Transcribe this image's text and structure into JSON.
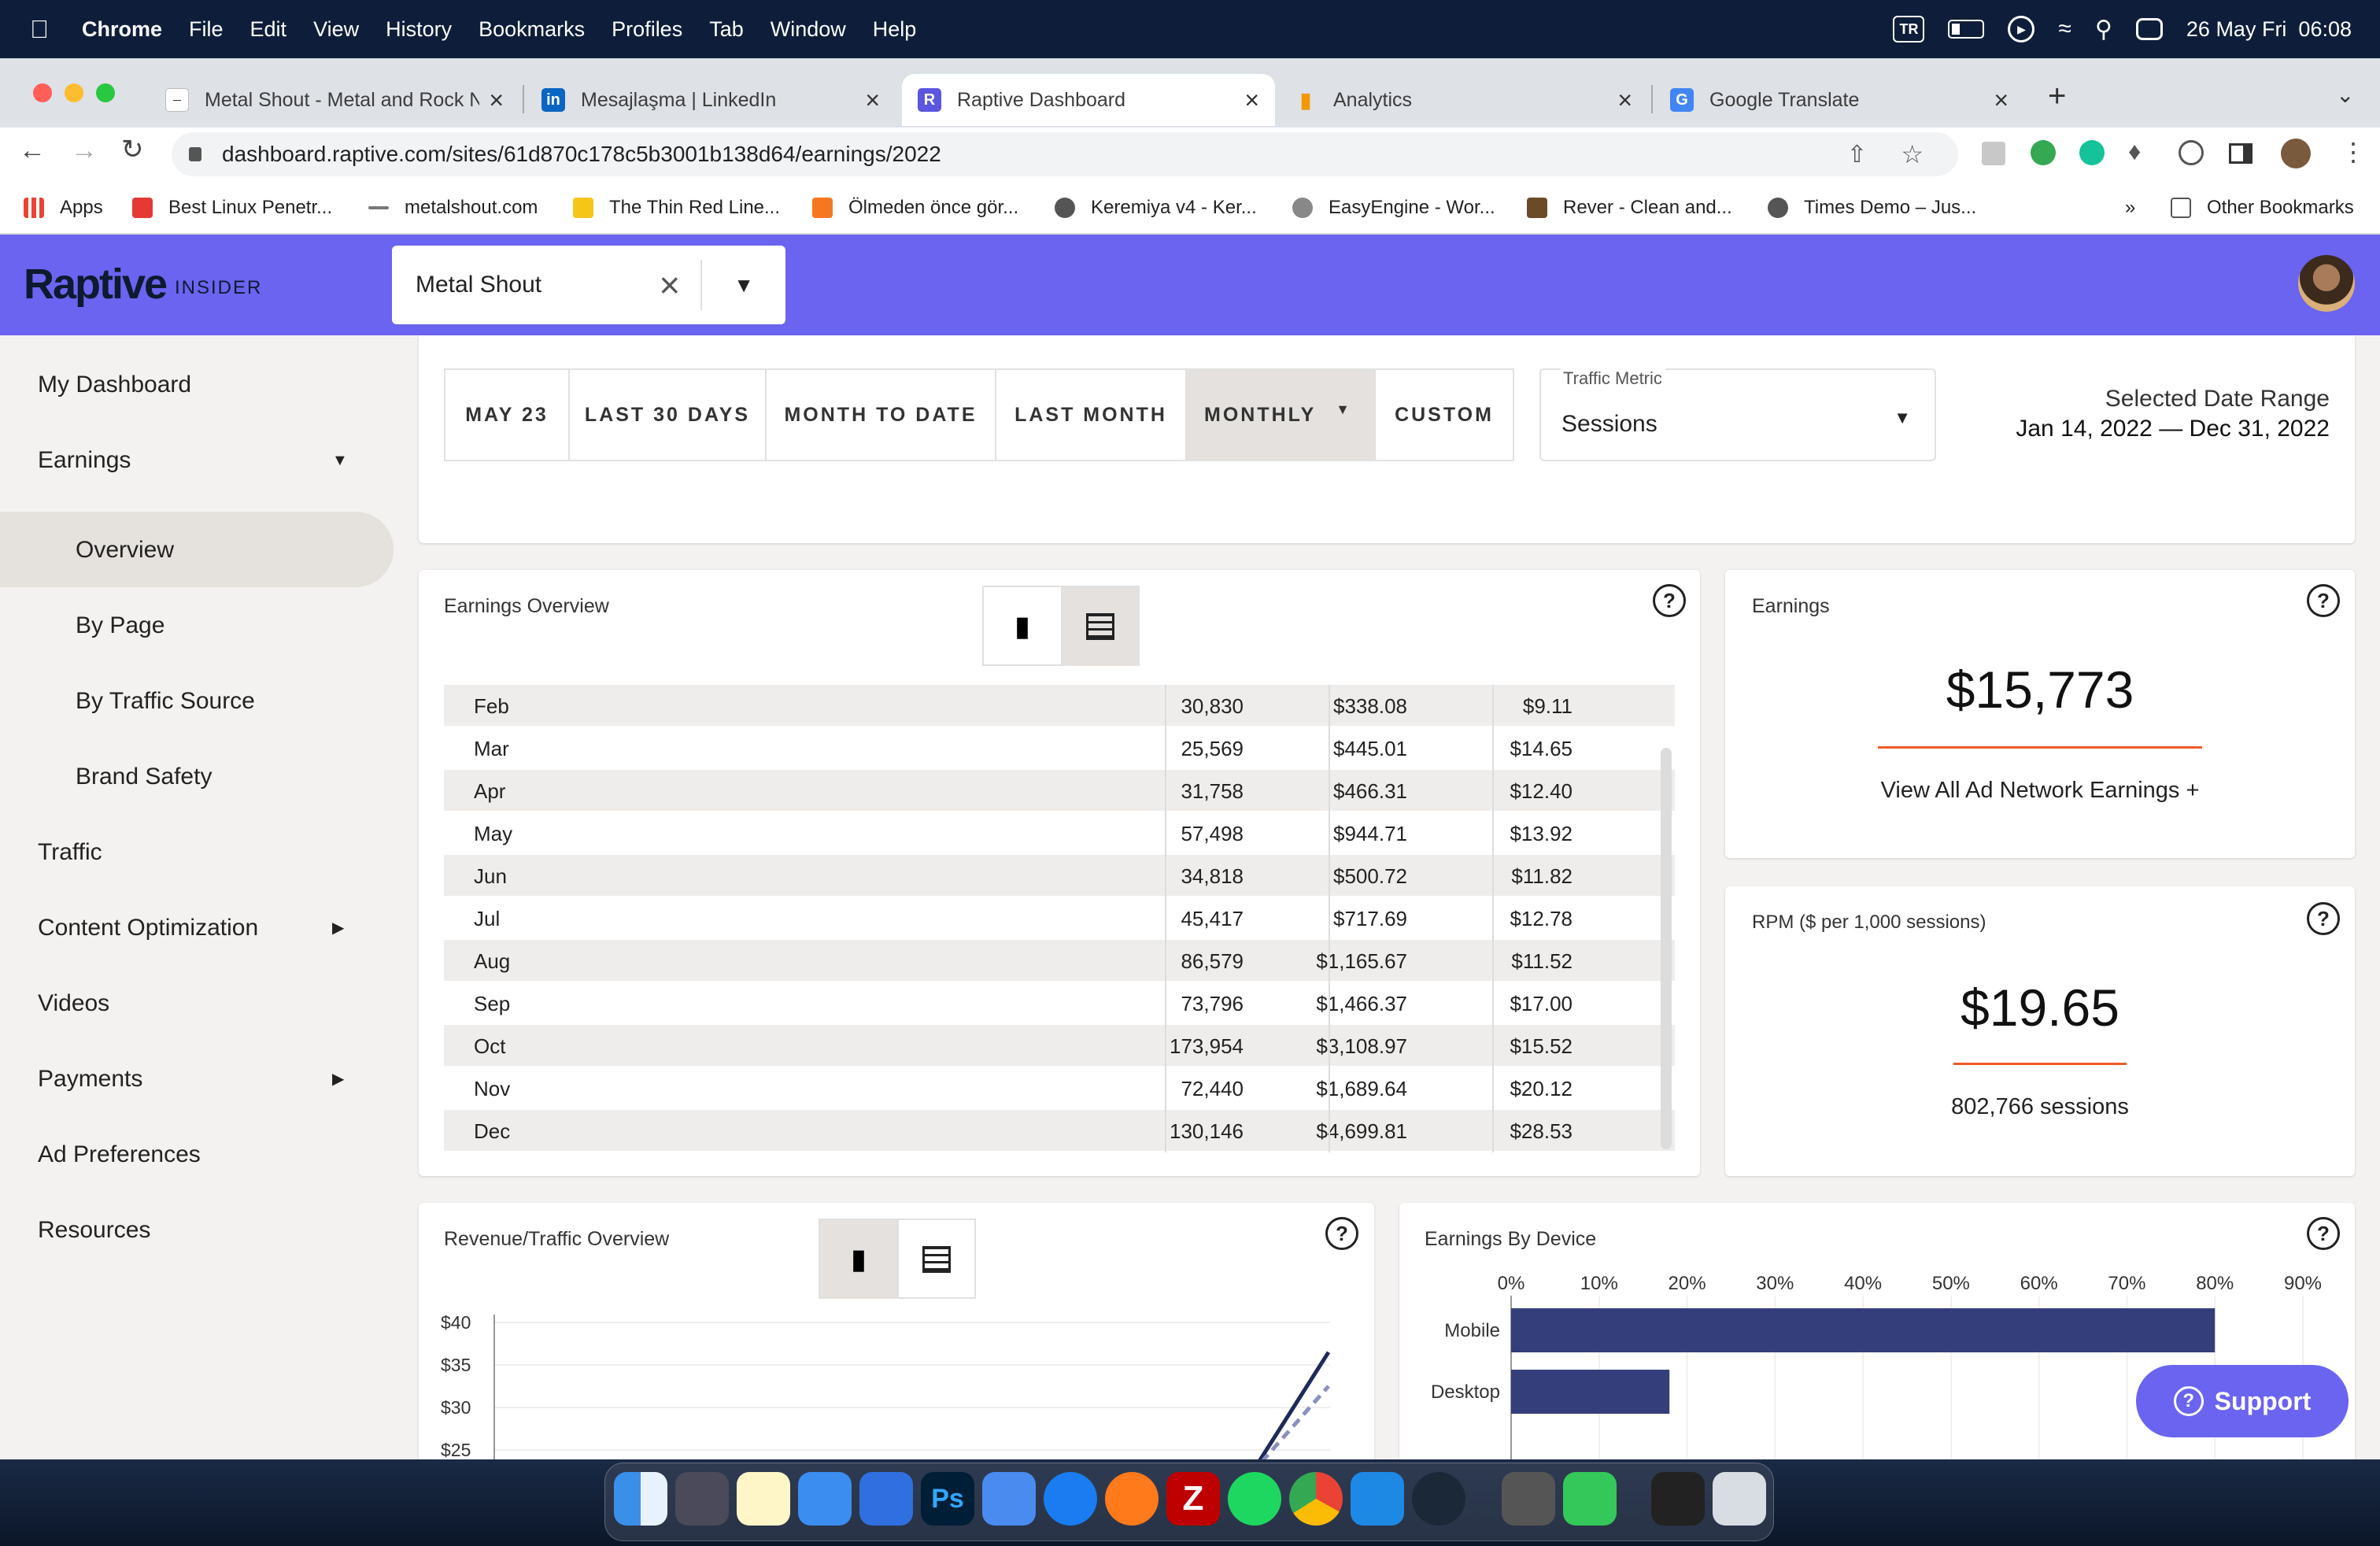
{
  "menubar": {
    "app": "Chrome",
    "items": [
      "File",
      "Edit",
      "View",
      "History",
      "Bookmarks",
      "Profiles",
      "Tab",
      "Window",
      "Help"
    ],
    "input_source": "TR",
    "datetime": "26 May Fri  06:08"
  },
  "tabs": [
    {
      "title": "Metal Shout - Metal and Rock N",
      "icon": "metalshout-favicon",
      "active": false
    },
    {
      "title": "Mesajlaşma | LinkedIn",
      "icon": "linkedin-favicon",
      "active": false
    },
    {
      "title": "Raptive Dashboard",
      "icon": "raptive-favicon",
      "active": true
    },
    {
      "title": "Analytics",
      "icon": "analytics-favicon",
      "active": false
    },
    {
      "title": "Google Translate",
      "icon": "translate-favicon",
      "active": false
    }
  ],
  "address": {
    "url": "dashboard.raptive.com/sites/61d870c178c5b3001b138d64/earnings/2022"
  },
  "bookmarks": [
    "Apps",
    "Best Linux Penetr...",
    "metalshout.com",
    "The Thin Red Line...",
    "Ölmeden önce gör...",
    "Keremiya v4 - Ker...",
    "EasyEngine - Wor...",
    "Rever - Clean and...",
    "Times Demo – Jus..."
  ],
  "bookmarks_more": "»",
  "other_bookmarks": "Other Bookmarks",
  "app": {
    "logo": "Raptive",
    "logo_sub": "INSIDER",
    "site_name": "Metal Shout"
  },
  "sidebar": {
    "items": [
      {
        "label": "My Dashboard"
      },
      {
        "label": "Earnings"
      },
      {
        "label": "Overview"
      },
      {
        "label": "By Page"
      },
      {
        "label": "By Traffic Source"
      },
      {
        "label": "Brand Safety"
      },
      {
        "label": "Traffic"
      },
      {
        "label": "Content Optimization"
      },
      {
        "label": "Videos"
      },
      {
        "label": "Payments"
      },
      {
        "label": "Ad Preferences"
      },
      {
        "label": "Resources"
      }
    ]
  },
  "range_buttons": [
    "MAY 23",
    "LAST 30 DAYS",
    "MONTH TO DATE",
    "LAST MONTH",
    "MONTHLY",
    "CUSTOM"
  ],
  "traffic_metric": {
    "label": "Traffic Metric",
    "value": "Sessions"
  },
  "date_range": {
    "label": "Selected Date Range",
    "value": "Jan 14, 2022 — Dec 31, 2022"
  },
  "earnings_overview": {
    "title": "Earnings Overview",
    "rows": [
      {
        "month": "Feb",
        "sessions": "30,830",
        "earnings": "$338.08",
        "rpm": "$9.11"
      },
      {
        "month": "Mar",
        "sessions": "25,569",
        "earnings": "$445.01",
        "rpm": "$14.65"
      },
      {
        "month": "Apr",
        "sessions": "31,758",
        "earnings": "$466.31",
        "rpm": "$12.40"
      },
      {
        "month": "May",
        "sessions": "57,498",
        "earnings": "$944.71",
        "rpm": "$13.92"
      },
      {
        "month": "Jun",
        "sessions": "34,818",
        "earnings": "$500.72",
        "rpm": "$11.82"
      },
      {
        "month": "Jul",
        "sessions": "45,417",
        "earnings": "$717.69",
        "rpm": "$12.78"
      },
      {
        "month": "Aug",
        "sessions": "86,579",
        "earnings": "$1,165.67",
        "rpm": "$11.52"
      },
      {
        "month": "Sep",
        "sessions": "73,796",
        "earnings": "$1,466.37",
        "rpm": "$17.00"
      },
      {
        "month": "Oct",
        "sessions": "173,954",
        "earnings": "$3,108.97",
        "rpm": "$15.52"
      },
      {
        "month": "Nov",
        "sessions": "72,440",
        "earnings": "$1,689.64",
        "rpm": "$20.12"
      },
      {
        "month": "Dec",
        "sessions": "130,146",
        "earnings": "$4,699.81",
        "rpm": "$28.53"
      }
    ]
  },
  "earnings_card": {
    "title": "Earnings",
    "value": "$15,773",
    "link": "View All Ad Network Earnings +"
  },
  "rpm_card": {
    "title": "RPM ($ per 1,000 sessions)",
    "value": "$19.65",
    "sub": "802,766 sessions"
  },
  "revenue_traffic": {
    "title": "Revenue/Traffic Overview",
    "y_ticks": [
      "$40",
      "$35",
      "$30",
      "$25"
    ]
  },
  "device": {
    "title": "Earnings By Device"
  },
  "support_label": "Support",
  "colors": {
    "brand": "#6a64f0",
    "accent": "#f15a29",
    "bar": "#343e7a"
  },
  "chart_data": [
    {
      "type": "bar",
      "orientation": "horizontal",
      "title": "Earnings By Device",
      "categories": [
        "Mobile",
        "Desktop"
      ],
      "values": [
        80,
        18
      ],
      "x_ticks": [
        "0%",
        "10%",
        "20%",
        "30%",
        "40%",
        "50%",
        "60%",
        "70%",
        "80%",
        "90%"
      ],
      "xlim": [
        0,
        90
      ]
    },
    {
      "type": "line",
      "title": "Revenue/Traffic Overview",
      "y_ticks": [
        "$40",
        "$35",
        "$30",
        "$25"
      ],
      "ylim": [
        25,
        40
      ],
      "series": [
        {
          "values": [
            25,
            36.5
          ]
        },
        {
          "values": [
            25,
            32.5
          ]
        }
      ]
    }
  ]
}
